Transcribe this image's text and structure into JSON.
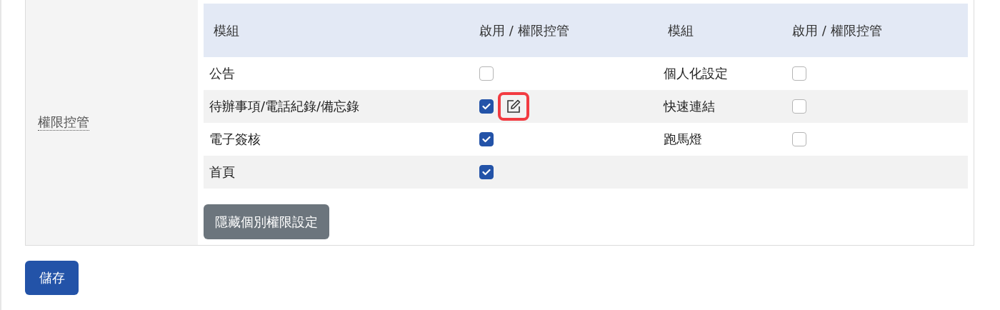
{
  "section": {
    "label": "權限控管",
    "columns": [
      "模組",
      "啟用 / 權限控管",
      "模組",
      "啟用 / 權限控管"
    ],
    "rows": [
      {
        "cells": [
          {
            "module": "公告",
            "checked": false
          },
          {
            "module": "個人化設定",
            "checked": false
          }
        ]
      },
      {
        "cells": [
          {
            "module": "待辦事項/電話紀錄/備忘錄",
            "checked": true,
            "edit_button": {
              "focused": true
            }
          },
          {
            "module": "快速連結",
            "checked": false
          }
        ]
      },
      {
        "cells": [
          {
            "module": "電子簽核",
            "checked": true
          },
          {
            "module": "跑馬燈",
            "checked": false
          }
        ]
      },
      {
        "cells": [
          {
            "module": "首頁",
            "checked": true
          }
        ]
      }
    ],
    "toggle_button": "隱藏個別權限設定"
  },
  "save_button": "儲存"
}
